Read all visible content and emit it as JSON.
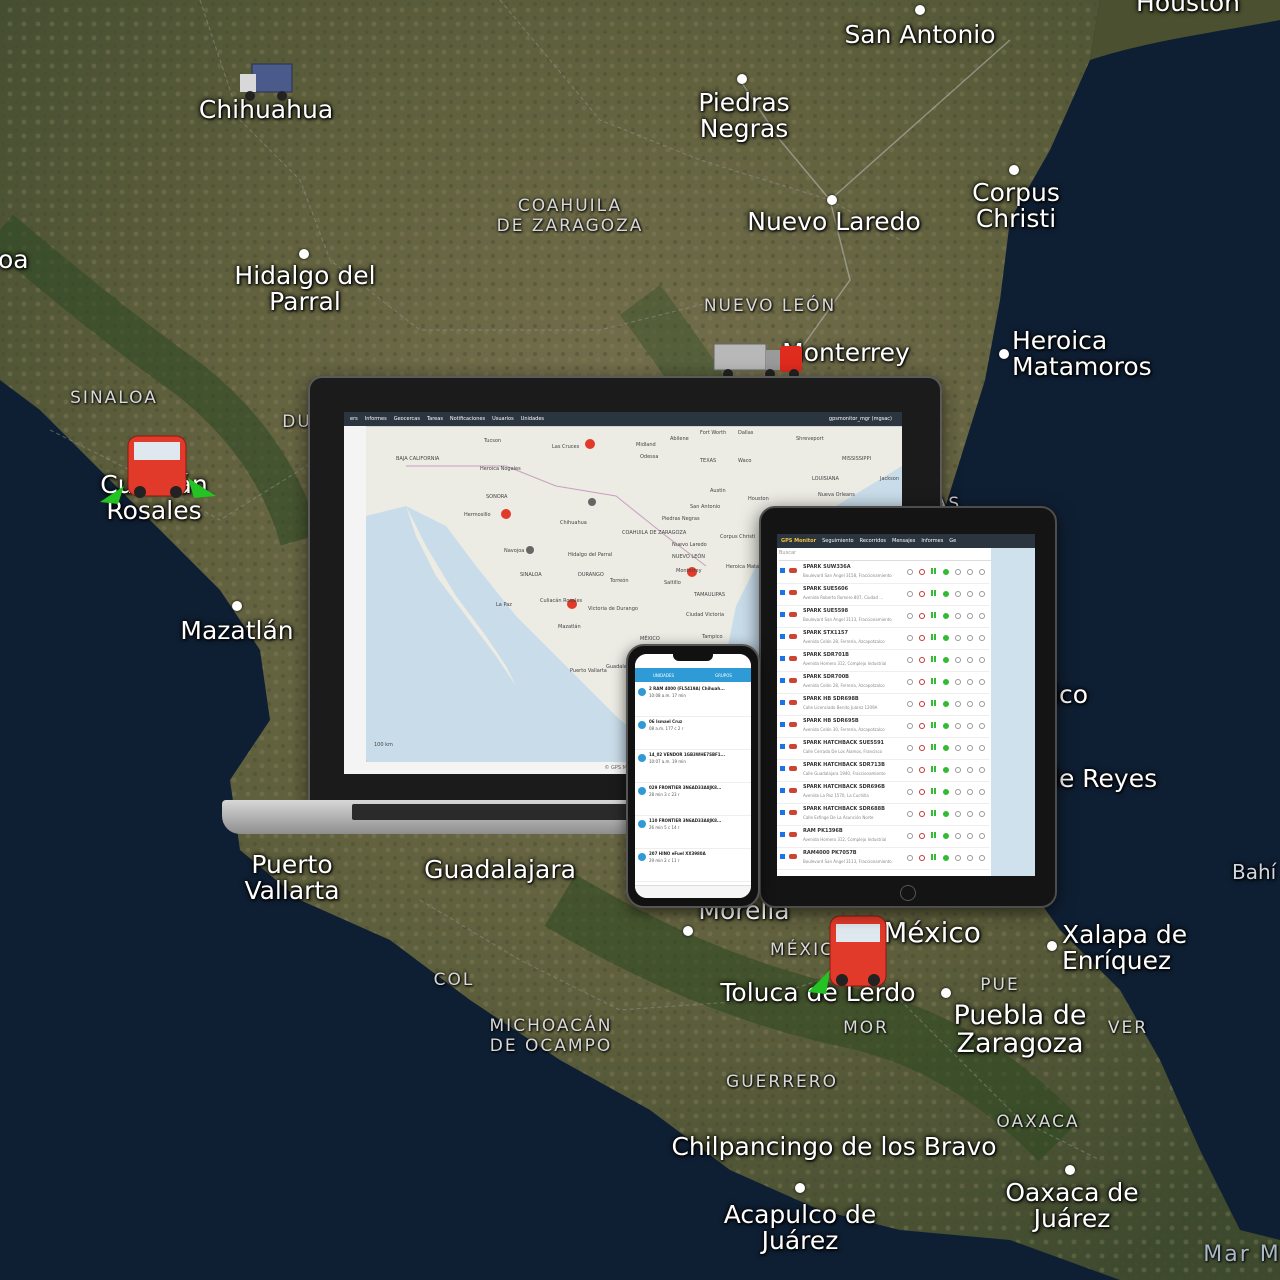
{
  "map": {
    "cities": [
      {
        "id": "san-antonio",
        "name": "San Antonio"
      },
      {
        "id": "houston",
        "name": "Houston"
      },
      {
        "id": "chihuahua",
        "name": "Chihuahua"
      },
      {
        "id": "piedras-negras",
        "name": "Piedras\nNegras"
      },
      {
        "id": "nuevo-laredo",
        "name": "Nuevo Laredo"
      },
      {
        "id": "corpus-christi",
        "name": "Corpus\nChristi"
      },
      {
        "id": "hidalgo-del-parral",
        "name": "Hidalgo del\nParral"
      },
      {
        "id": "monterrey",
        "name": "Monterrey"
      },
      {
        "id": "heroica-matamoros",
        "name": "Heroica\nMatamoros"
      },
      {
        "id": "culiacan-rosales",
        "name": "Culiacán\nRosales"
      },
      {
        "id": "mazatlan",
        "name": "Mazatlán"
      },
      {
        "id": "puerto-vallarta",
        "name": "Puerto\nVallarta"
      },
      {
        "id": "guadalajara",
        "name": "Guadalajara"
      },
      {
        "id": "morelia",
        "name": "Morelia"
      },
      {
        "id": "mexico",
        "name": "México"
      },
      {
        "id": "xalapa",
        "name": "Xalapa de\nEnríquez"
      },
      {
        "id": "toluca",
        "name": "Toluca de Lerdo"
      },
      {
        "id": "puebla",
        "name": "Puebla de\nZaragoza"
      },
      {
        "id": "chilpancingo",
        "name": "Chilpancingo de los Bravo"
      },
      {
        "id": "oaxaca",
        "name": "Oaxaca de\nJuárez"
      },
      {
        "id": "acapulco",
        "name": "Acapulco de\nJuárez"
      },
      {
        "id": "oa-fragment",
        "name": "oa"
      },
      {
        "id": "ico-fragment",
        "name": "ico"
      },
      {
        "id": "reyes-fragment",
        "name": "le Reyes"
      },
      {
        "id": "bahi-fragment",
        "name": "Bahí"
      }
    ],
    "states": [
      {
        "id": "coahuila",
        "name": "COAHUILA\nDE ZARAGOZA"
      },
      {
        "id": "nuevo-leon",
        "name": "NUEVO LEÓN"
      },
      {
        "id": "sinaloa",
        "name": "SINALOA"
      },
      {
        "id": "durango-fragment",
        "name": "DU"
      },
      {
        "id": "col",
        "name": "COL"
      },
      {
        "id": "michoacan",
        "name": "MICHOACÁN\nDE OCAMPO"
      },
      {
        "id": "mexico-state",
        "name": "MÉXIC"
      },
      {
        "id": "pue",
        "name": "PUE"
      },
      {
        "id": "ver",
        "name": "VER"
      },
      {
        "id": "mor",
        "name": "MOR"
      },
      {
        "id": "guerrero",
        "name": "GUERRERO"
      },
      {
        "id": "oaxaca-state",
        "name": "OAXACA"
      },
      {
        "id": "mar",
        "name": "Mar M"
      },
      {
        "id": "as-fragment",
        "name": "AS"
      }
    ]
  },
  "laptop": {
    "menu": [
      "ers",
      "Informes",
      "Geocercas",
      "Tareas",
      "Notificaciones",
      "Usuarios",
      "Unidades"
    ],
    "user": "gpsmonitor_mgr (mgsac)",
    "footer": "© GPS Monitor",
    "labels": [
      "Tucson",
      "Las Cruces",
      "Midland",
      "Abilene",
      "Fort Worth",
      "Dallas",
      "Shreveport",
      "Odessa",
      "TEXAS",
      "Waco",
      "MISSISSIPPI",
      "Heroica Nogales",
      "LOUISIANA",
      "Jackson",
      "Austin",
      "Houston",
      "Nueva Orleans",
      "San Antonio",
      "Hermosillo",
      "Chihuahua",
      "Nuevo Laredo",
      "Piedras Negras",
      "Corpus Christi",
      "Monterrey",
      "Saltillo",
      "Heroica Matamoros",
      "Hidalgo del Parral",
      "Navojoa",
      "La Paz",
      "Culiacán Rosales",
      "Victoria de Durango",
      "Torreón",
      "Ciudad Victoria",
      "MÉXICO",
      "Mazatlán",
      "Tampico",
      "Puerto Vallarta",
      "Guadalajara",
      "BAJA CALIFORNIA",
      "SONORA",
      "COAHUILA DE ZARAGOZA",
      "DURANGO",
      "SINALOA",
      "NUEVO LEÓN",
      "TAMAULIPAS",
      "100 km"
    ]
  },
  "tablet": {
    "tabs": [
      "GPS Monitor",
      "Seguimiento",
      "Recorridos",
      "Mensajes",
      "Informes",
      "Ge"
    ],
    "search": "Buscar",
    "rows": [
      {
        "plate": "SPARK SUW336A",
        "addr": "Boulevard San Ángel 3158, Fraccionamiento"
      },
      {
        "plate": "SPARK SUE5606",
        "addr": "Avenida Roberto Romero 807, Ciudad ..."
      },
      {
        "plate": "SPARK SUE5598",
        "addr": "Boulevard San Ángel 3113, Fraccionamiento"
      },
      {
        "plate": "SPARK STX1157",
        "addr": "Avenida Colón 28, Ferrería, Azcapotzalco"
      },
      {
        "plate": "SPARK SDR701B",
        "addr": "Avenida Homero 312, Complejo Industrial"
      },
      {
        "plate": "SPARK SDR700B",
        "addr": "Avenida Colón 28, Ferrería, Azcapotzalco"
      },
      {
        "plate": "SPARK HB SDR698B",
        "addr": "Calle Licenciado Benito Juárez 1209A"
      },
      {
        "plate": "SPARK HB SDR695B",
        "addr": "Avenida Colón 30, Ferrería, Azcapotzalco"
      },
      {
        "plate": "SPARK HATCHBACK SUE5591",
        "addr": "Calle Cerrada De Los Álamos, Francisco"
      },
      {
        "plate": "SPARK HATCHBACK SDR713B",
        "addr": "Calle Guadalajara 1940, Fraccionamiento"
      },
      {
        "plate": "SPARK HATCHBACK SDR696B",
        "addr": "Avenida La Paz 1570, La Cuchilla"
      },
      {
        "plate": "SPARK HATCHBACK SDR688B",
        "addr": "Calle Esfinge De La Asunción Norte"
      },
      {
        "plate": "RAM PK1396B",
        "addr": "Avenida Homero 312, Complejo Industrial"
      },
      {
        "plate": "RAM4000 PK7057B",
        "addr": "Boulevard San Ángel 3113, Fraccionamiento"
      }
    ]
  },
  "phone": {
    "tabs": [
      "UNIDADES",
      "GRUPOS"
    ],
    "items": [
      {
        "title": "2 RAM 4000 (FL5419A) Chihuah...",
        "sub": "10:08 a.m.  17 min"
      },
      {
        "title": "06 Ismael Cruz",
        "sub": "08 a.m.  177 c 2 r"
      },
      {
        "title": "14_02 VENDOR 1GB3WHE7SBF1...",
        "sub": "10:07 a.m.  19 min"
      },
      {
        "title": "029 FRONTIER 3N6AD33A8JK8...",
        "sub": "28 min  3 c 23 r"
      },
      {
        "title": "110 FRONTIER 3N6AD33A8JK8...",
        "sub": "26 min  5 c 14 r"
      },
      {
        "title": "207 HINO eFuel XX3980A",
        "sub": "29 min  2 c 11 r"
      }
    ]
  },
  "colors": {
    "ocean": "#0f1f33",
    "land": "#5a5a3a",
    "marker": "#e23a2a",
    "arrow": "#22c322",
    "screen_header": "#2b3540",
    "phone_accent": "#2e9bd6"
  }
}
